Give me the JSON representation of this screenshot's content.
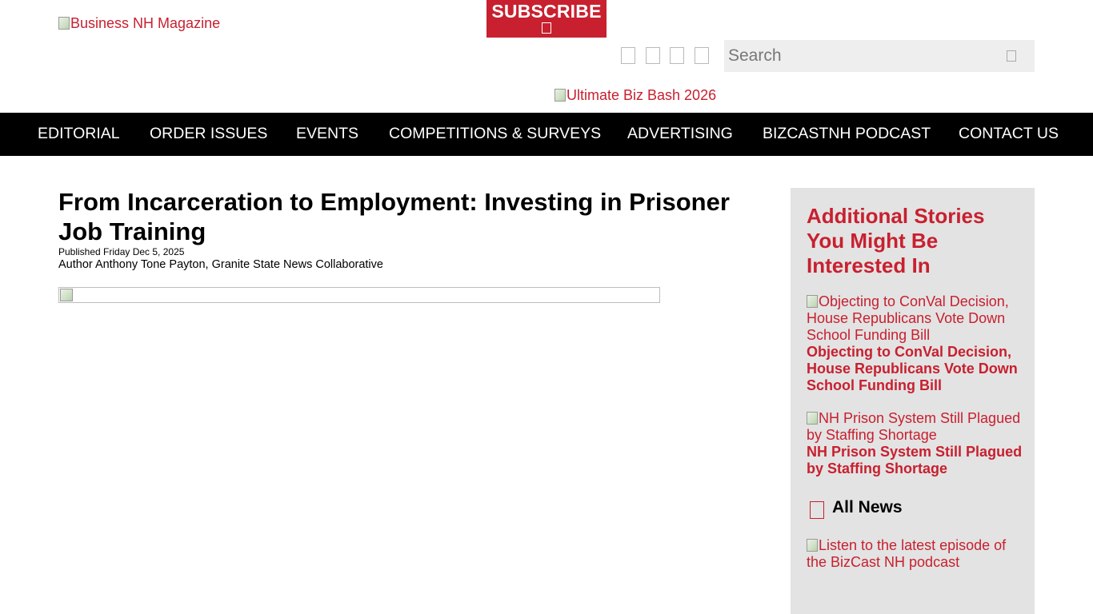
{
  "header": {
    "logo_alt": "Business NH Magazine",
    "subscribe_label": "SUBSCRIBE",
    "social_icons": [
      "facebook-icon",
      "twitter-icon",
      "linkedin-icon",
      "instagram-icon"
    ],
    "search_placeholder": "Search",
    "promo_alt": "Ultimate Biz Bash 2026"
  },
  "nav": {
    "items": [
      {
        "label": "EDITORIAL"
      },
      {
        "label": "ORDER ISSUES"
      },
      {
        "label": "EVENTS"
      },
      {
        "label": "COMPETITIONS & SURVEYS"
      },
      {
        "label": "ADVERTISING"
      },
      {
        "label": "BIZCASTNH PODCAST"
      },
      {
        "label": "CONTACT US"
      }
    ]
  },
  "article": {
    "title": "From Incarceration to Employment: Investing in Prisoner Job Training",
    "published": "Published Friday Dec 5, 2025",
    "author": "Author Anthony Tone Payton, Granite State News Collaborative"
  },
  "sidebar": {
    "heading": "Additional Stories You Might Be Interested In",
    "stories": [
      {
        "image_alt": "Objecting to ConVal Decision, House Republicans Vote Down School Funding Bill",
        "title": "Objecting to ConVal Decision, House Republicans Vote Down School Funding Bill"
      },
      {
        "image_alt": "NH Prison System Still Plagued by Staffing Shortage",
        "title": "NH Prison System Still Plagued by Staffing Shortage"
      }
    ],
    "all_news_label": "All News",
    "podcast_alt": "Listen to the latest episode of the BizCast NH podcast"
  },
  "colors": {
    "brand_red": "#c8202f",
    "nav_background": "#000000",
    "sidebar_background": "#e3e3e3",
    "search_background": "#eeeeee"
  }
}
